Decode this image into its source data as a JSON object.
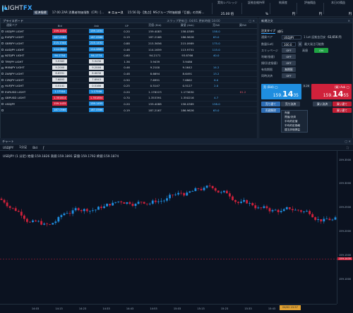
{
  "app": {
    "logo_brand": "LIGHT",
    "logo_fx": "FX"
  },
  "ticker": {
    "badge": "経済指標",
    "items": [
      "17:00 ZAR 消費者物価指数（CPI）[...",
      "ニュース",
      "15:56 DJ-【焦点】MSグループ時価総額「巨額」の判断..."
    ]
  },
  "stats": [
    {
      "label": "実効レバレッジ",
      "value": "25.00 倍"
    },
    {
      "label": "証拠金維持率",
      "value": "%"
    },
    {
      "label": "純資産",
      "value": "円"
    },
    {
      "label": "評価損益",
      "value": "円"
    },
    {
      "label": "本日の損益",
      "value": "円"
    }
  ],
  "priceboard": {
    "title": "プライスボード",
    "note": "スワップ更新日: 04/01 更新時間 18:00",
    "columns": [
      "通貨ペア",
      "Bid",
      "Ask",
      "SP",
      "売値 (Bid)",
      "買値 (Ask)",
      "売SW",
      "買SW"
    ],
    "rows": [
      {
        "pair": "USDJPY LIGHT",
        "bid": "159.1434",
        "ask": "159.1454",
        "sp": "0.20",
        "sell": "159.4083",
        "buy": "158.0389",
        "ssw": "158.0",
        "bsw": "",
        "bid_c": "r",
        "ask_c": "b"
      },
      {
        "pair": "EURJPY LIGHT",
        "bid": "187.0566",
        "ask": "187.0566",
        "sp": "0.19",
        "sell": "187.2168",
        "buy": "186.9626",
        "ssw": "63.0",
        "bsw": "",
        "bid_c": "b",
        "ask_c": "b"
      },
      {
        "pair": "GBPJPY LIGHT",
        "bid": "215.1344",
        "ask": "215.1432",
        "sp": "0.88",
        "sell": "215.3656",
        "buy": "215.0989",
        "ssw": "175.0",
        "bsw": "",
        "bid_c": "b",
        "ask_c": "b"
      },
      {
        "pair": "AUDJPY LIGHT",
        "bid": "114.0800",
        "ask": "114.0889",
        "sp": "0.48",
        "sell": "114.1659",
        "buy": "113.9751",
        "ssw": "115.0",
        "bsw": "",
        "bid_c": "b",
        "ask_c": "b"
      },
      {
        "pair": "NZDJPY LIGHT",
        "bid": "94.1754",
        "ask": "94.1774",
        "sp": "0.60",
        "sell": "94.2171",
        "buy": "93.8766",
        "ssw": "40.0",
        "bsw": "",
        "bid_c": "b",
        "ask_c": "b"
      },
      {
        "pair": "TRYJPY LIGHT",
        "bid": "3.9383",
        "ask": "3.9436",
        "sp": "1.36",
        "sell": "3.9439",
        "buy": "3.9486",
        "ssw": "",
        "bsw": "",
        "bid_c": "n",
        "ask_c": "n"
      },
      {
        "pair": "MXNJPY LIGHT",
        "bid": "9.2000",
        "ask": "9.2046",
        "sp": "0.46",
        "sell": "9.2100",
        "buy": "9.1642",
        "ssw": "14.2",
        "bsw": "",
        "bid_c": "n",
        "ask_c": "n"
      },
      {
        "pair": "ZARJPY LIGHT",
        "bid": "8.6591",
        "ask": "8.6638",
        "sp": "0.48",
        "sell": "8.6694",
        "buy": "8.6491",
        "ssw": "13.2",
        "bsw": "",
        "bid_c": "n",
        "ask_c": "n"
      },
      {
        "pair": "CZKJPY LIGHT",
        "bid": "7.6893",
        "ask": "7.6943",
        "sp": "0.50",
        "sell": "7.6991",
        "buy": "7.6862",
        "ssw": "8.0",
        "bsw": "",
        "bid_c": "n",
        "ask_c": "n"
      },
      {
        "pair": "HUFJPY LIGHT",
        "bid": "0.5141",
        "ask": "0.5166",
        "sp": "0.25",
        "sell": "0.5147",
        "buy": "0.5127",
        "ssw": "2.0",
        "bsw": "",
        "bid_c": "n",
        "ask_c": "n"
      },
      {
        "pair": "EURUSD LIGHT",
        "bid": "1.17504",
        "ask": "1.17506",
        "sp": "0.20",
        "sell": "1.176223",
        "buy": "1.173630",
        "ssw": "",
        "bsw": "81.2",
        "bid_c": "b",
        "ask_c": "b"
      },
      {
        "pair": "GBPUSD LIGHT",
        "bid": "1.351814",
        "ask": "1.351854",
        "sp": "0.70",
        "sell": "1.353391",
        "buy": "1.350216",
        "ssw": "4.7",
        "bsw": "",
        "bid_c": "r",
        "ask_c": "r"
      },
      {
        "pair": "USDJPY",
        "bid": "159.1435",
        "ask": "159.1455",
        "sp": "0.20",
        "sell": "159.4088",
        "buy": "158.0389",
        "ssw": "158.0",
        "bsw": "",
        "bid_c": "r",
        "ask_c": "b"
      },
      {
        "pair": "",
        "bid": "187.0566",
        "ask": "187.0566",
        "sp": "0.19",
        "sell": "187.2167",
        "buy": "186.9626",
        "ssw": "63.0",
        "bsw": "",
        "bid_c": "b",
        "ask_c": "b"
      }
    ]
  },
  "order": {
    "title": "新規注文",
    "type_label": "注文タイプ",
    "type_value": "成行",
    "pair_label": "通貨ペア",
    "pair_value": "USDJPY",
    "lot_label": "1 Lot 証拠金目安",
    "lot_value": "63,656 円",
    "qty_label": "数量(Lot)",
    "qty_value": "100.0",
    "qty_right": "最大発注可能数",
    "slip_label": "スリッページ",
    "slip_value": "OFF",
    "slip_mode": "高値",
    "on": "ON",
    "limit_label": "利確(指値)",
    "limit_value": "OFF",
    "stop_label": "損切(逆指値)",
    "stop_value": "OFF",
    "ifd_label": "有効期限",
    "ifd_value": "無期限",
    "ifo_label": "同時決済",
    "ifo_value": "OFF",
    "bid_label": "売 (Bid) ◯",
    "bid_big": "14",
    "bid_small": "35",
    "bid_prefix": "159.",
    "ask_label": "(買) Ask ◯",
    "ask_big": "14",
    "ask_small": "55",
    "ask_prefix": "159.",
    "spread": "0.20",
    "a1": "売り建て",
    "a2": "買い建て",
    "a3": "売り決済",
    "a4": "買い決済",
    "a5": "両建解除",
    "a6": "買い建て"
  },
  "menu": [
    "売値",
    "買値/決済",
    "平均約定値",
    "平均約定価格",
    "建玉評価損益"
  ],
  "chart": {
    "title": "チャート",
    "pair": "USDJPY",
    "tf": "1分足",
    "mode": "Bid",
    "info": "USDJPY (1 分足) 始値:159.1826 高値:159.1891 安値:159.1792 終値:159.1874",
    "yticks": [
      "159.3500",
      "159.3000",
      "159.2500",
      "159.2000",
      "159.1500",
      "159.1435",
      "159.1000"
    ],
    "yvals": [
      159.35,
      159.3,
      159.25,
      159.2,
      159.15,
      159.1435,
      159.1
    ],
    "xticks": [
      "14:03",
      "14:13",
      "14:23",
      "14:33",
      "14:43",
      "14:53",
      "15:03",
      "15:13",
      "15:23",
      "15:33",
      "15:43",
      "15:53"
    ],
    "last": "159.1435",
    "time_badge": "04/02 15:57"
  },
  "colors": {
    "up": "#1f8ee0",
    "down": "#d0213b",
    "accent": "#3aa7ff"
  }
}
